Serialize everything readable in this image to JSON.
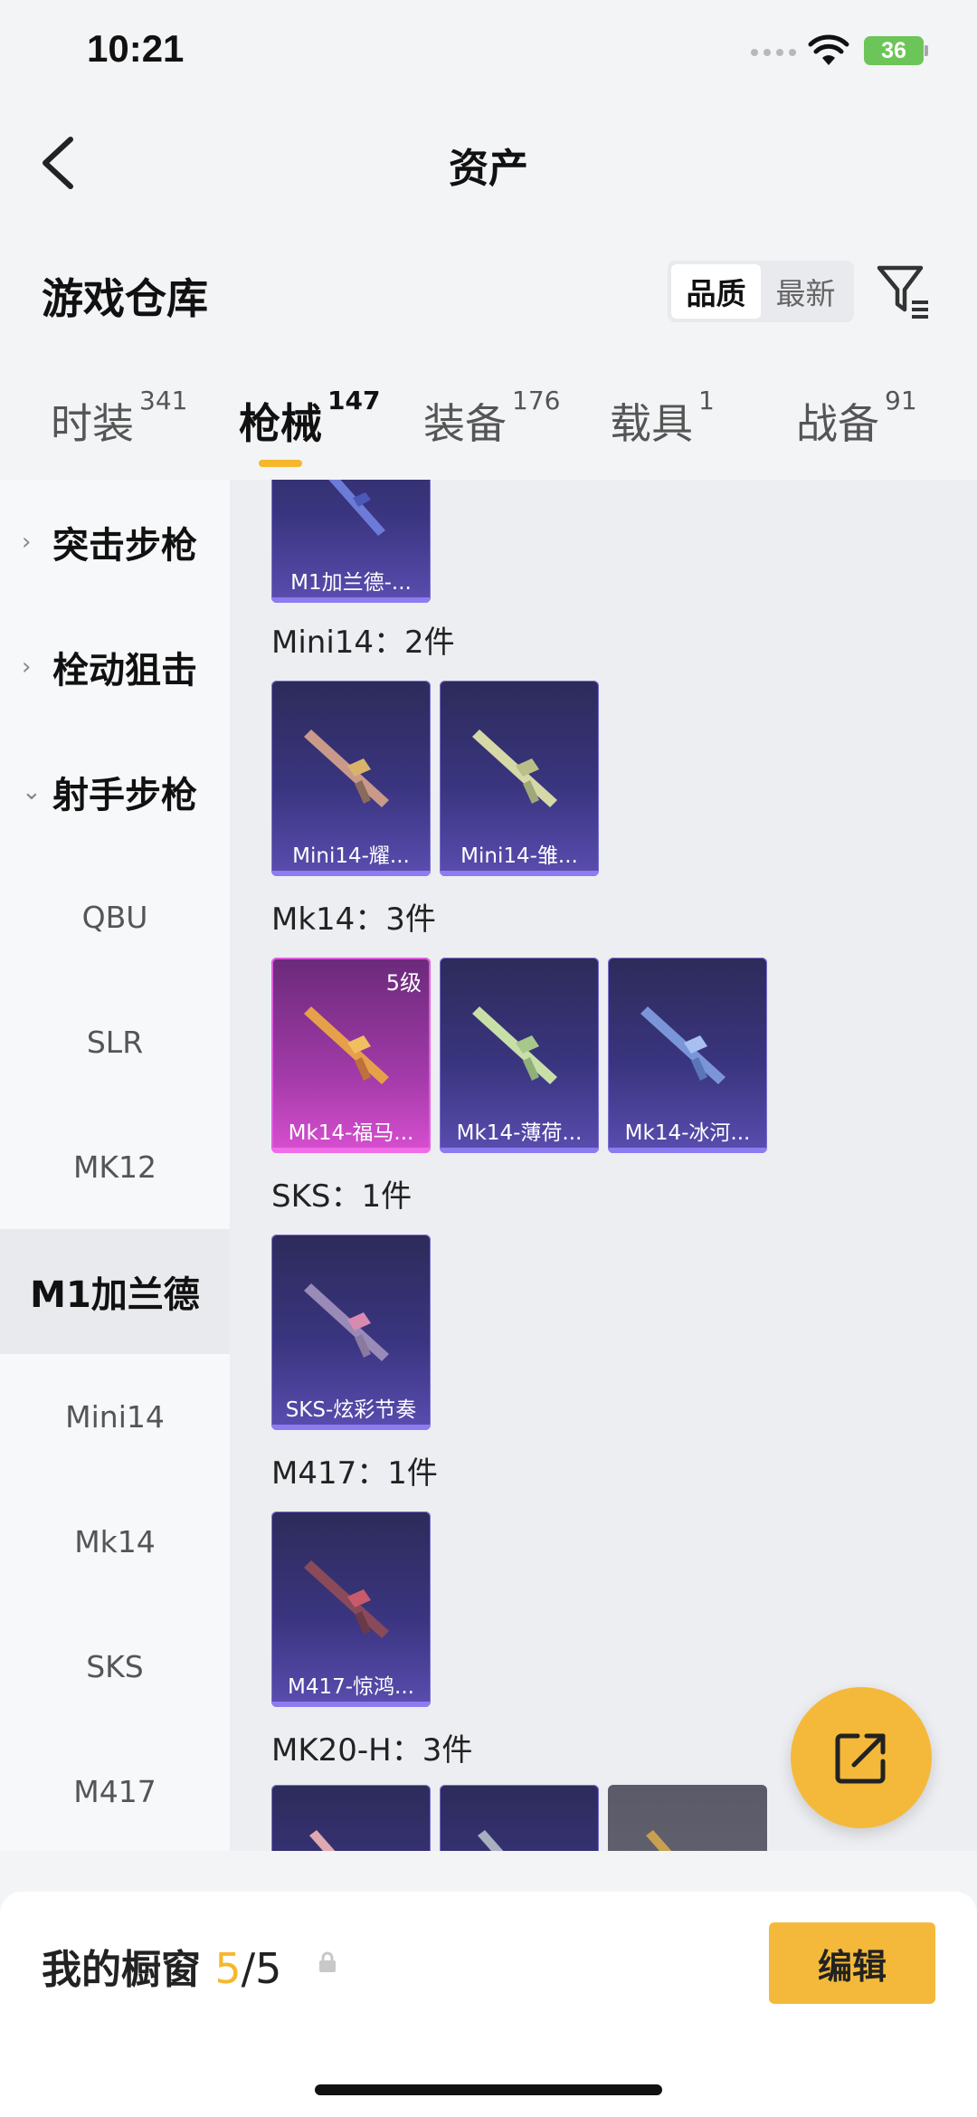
{
  "status_bar": {
    "time": "10:21",
    "battery": "36"
  },
  "header": {
    "title": "资产",
    "back_icon": "chevron-left-icon"
  },
  "warehouse": {
    "title": "游戏仓库",
    "sort_options": [
      "品质",
      "最新"
    ],
    "sort_selected": "品质",
    "filter_icon": "filter-icon"
  },
  "tabs": [
    {
      "label": "时装",
      "count": "341"
    },
    {
      "label": "枪械",
      "count": "147",
      "active": true
    },
    {
      "label": "装备",
      "count": "176"
    },
    {
      "label": "载具",
      "count": "1"
    },
    {
      "label": "战备",
      "count": "91"
    }
  ],
  "sidenav": {
    "categories": [
      "突击步枪",
      "栓动狙击",
      "射手步枪"
    ],
    "subitems": [
      "QBU",
      "SLR",
      "MK12",
      "M1加兰德",
      "Mini14",
      "Mk14",
      "SKS",
      "M417"
    ],
    "selected": "M1加兰德"
  },
  "groups": [
    {
      "label": "",
      "items": [
        {
          "name": "M1加兰德-..."
        }
      ]
    },
    {
      "label": "Mini14：2件",
      "items": [
        {
          "name": "Mini14-耀..."
        },
        {
          "name": "Mini14-雏..."
        }
      ]
    },
    {
      "label": "Mk14：3件",
      "items": [
        {
          "name": "Mk14-福马...",
          "grade": "5级"
        },
        {
          "name": "Mk14-薄荷..."
        },
        {
          "name": "Mk14-冰河..."
        }
      ]
    },
    {
      "label": "SKS：1件",
      "items": [
        {
          "name": "SKS-炫彩节奏"
        }
      ]
    },
    {
      "label": "M417：1件",
      "items": [
        {
          "name": "M417-惊鸿..."
        }
      ]
    },
    {
      "label": "MK20-H：3件",
      "items": [
        {
          "name": ""
        },
        {
          "name": ""
        },
        {
          "name": ""
        }
      ]
    }
  ],
  "showcase": {
    "label": "我的橱窗",
    "current": "5",
    "total": "/5",
    "edit_label": "编辑"
  },
  "colors": {
    "accent": "#f5b72c",
    "card_blue": "#3a3580",
    "card_pink": "#a23aa8"
  }
}
